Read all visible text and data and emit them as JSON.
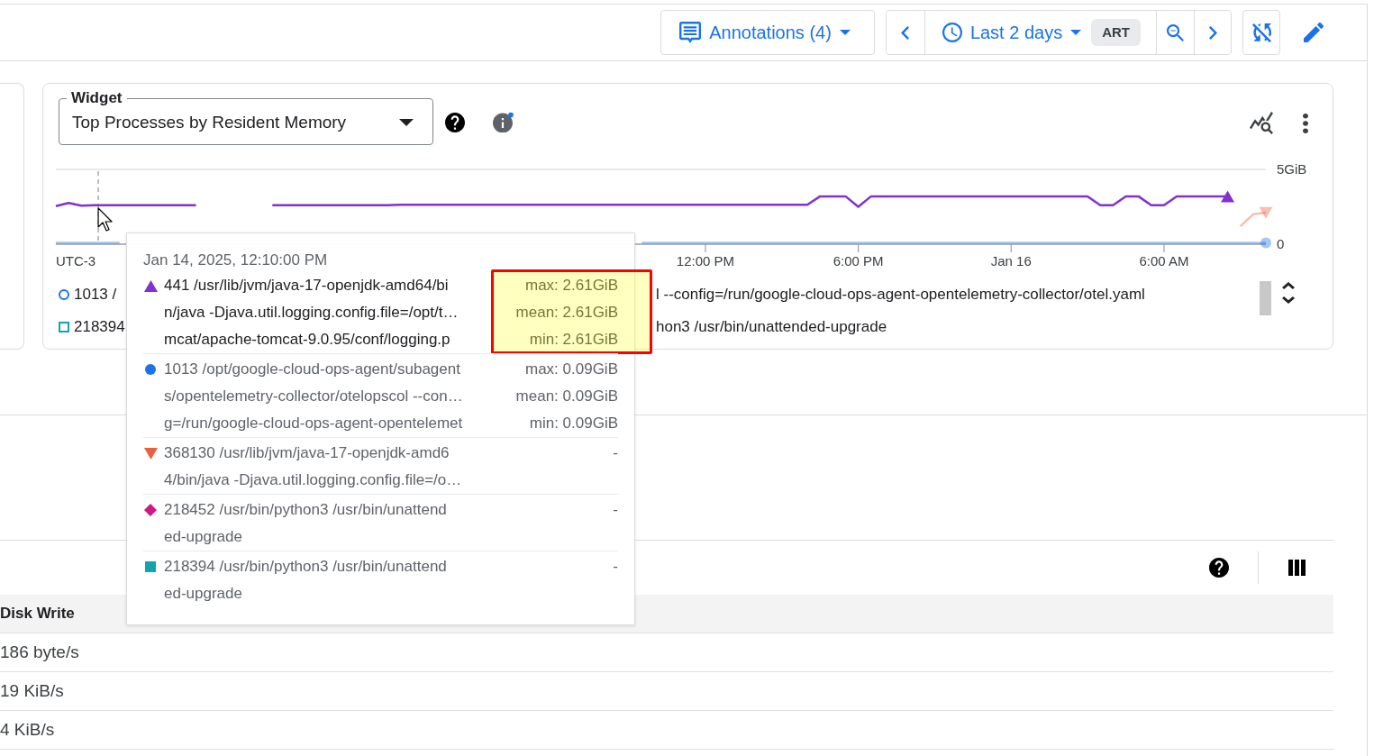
{
  "toolbar": {
    "annotations": "Annotations (4)",
    "range": "Last 2 days",
    "timezone": "ART"
  },
  "widget": {
    "label": "Widget",
    "value": "Top Processes by Resident Memory",
    "info_dot": true,
    "chart_data": {
      "type": "line",
      "xlabel": "UTC-3",
      "categories": [
        null,
        null,
        null,
        null,
        null,
        null,
        null,
        null,
        null,
        null,
        null,
        null,
        null,
        null,
        null,
        null,
        null,
        null,
        null,
        null,
        null,
        null,
        null,
        null,
        null,
        null,
        null,
        null,
        null,
        null,
        null,
        null,
        null,
        null,
        null,
        null,
        null,
        null,
        null,
        null,
        null,
        null,
        null,
        null,
        null,
        null,
        null,
        null,
        null,
        null,
        null,
        "12:00 PM",
        null,
        null,
        null,
        null,
        null,
        null,
        null,
        null,
        null,
        null,
        null,
        "6:00 PM",
        null,
        null,
        null,
        null,
        null,
        null,
        null,
        null,
        null,
        null,
        null,
        "Jan 16",
        null,
        null,
        null,
        null,
        null,
        null,
        null,
        null,
        null,
        null,
        null,
        "6:00 AM",
        null,
        null,
        null,
        null,
        null,
        null,
        null,
        null
      ],
      "ylim": [
        0,
        5
      ],
      "yticks": [
        {
          "value": 0,
          "label": "0"
        },
        {
          "value": 5,
          "label": "5GiB"
        }
      ],
      "series": [
        {
          "color": "#8430ce",
          "values": [
            2.55,
            2.75,
            2.58,
            2.61,
            2.61,
            2.61,
            2.61,
            2.61,
            2.61,
            2.61,
            2.61,
            2.61,
            null,
            null,
            null,
            null,
            null,
            2.6,
            2.6,
            2.6,
            2.6,
            2.6,
            2.6,
            2.6,
            2.6,
            2.6,
            2.6,
            2.63,
            2.63,
            2.63,
            2.63,
            2.63,
            2.63,
            2.63,
            2.63,
            2.63,
            2.63,
            2.63,
            2.63,
            2.63,
            2.63,
            2.63,
            2.63,
            2.63,
            2.63,
            2.63,
            2.63,
            2.63,
            2.63,
            2.63,
            2.63,
            2.63,
            2.63,
            2.63,
            2.63,
            2.63,
            2.63,
            2.63,
            2.63,
            2.63,
            3.2,
            3.2,
            3.2,
            2.5,
            3.2,
            3.2,
            3.2,
            3.2,
            3.2,
            3.2,
            3.2,
            3.2,
            3.2,
            3.2,
            3.2,
            3.2,
            3.2,
            3.2,
            3.2,
            3.2,
            3.2,
            3.2,
            2.6,
            2.6,
            3.2,
            3.2,
            2.6,
            2.6,
            3.2,
            3.2,
            3.2,
            3.2,
            3.2,
            null,
            null,
            null
          ]
        },
        {
          "color": "#1a73e8",
          "values": [
            0.09,
            0.09,
            0.09,
            0.09,
            0.09,
            0.09,
            null,
            null,
            null,
            null,
            null,
            null,
            null,
            null,
            null,
            null,
            null,
            null,
            null,
            null,
            null,
            null,
            null,
            null,
            null,
            null,
            null,
            null,
            null,
            null,
            null,
            null,
            null,
            null,
            null,
            null,
            null,
            null,
            null,
            null,
            null,
            null,
            null,
            null,
            null,
            null,
            0.09,
            0.09,
            0.09,
            0.09,
            0.09,
            0.09,
            0.09,
            0.09,
            0.09,
            0.09,
            0.09,
            0.09,
            0.09,
            0.09,
            0.09,
            0.09,
            0.09,
            0.09,
            0.09,
            0.09,
            0.09,
            0.09,
            0.09,
            0.09,
            0.09,
            0.09,
            0.09,
            0.09,
            0.09,
            0.09,
            0.09,
            0.09,
            0.09,
            0.09,
            0.09,
            0.09,
            0.09,
            0.09,
            0.09,
            0.09,
            0.09,
            0.09,
            0.09,
            0.09,
            0.09,
            0.09,
            0.09,
            0.09,
            0.09,
            0.09
          ]
        },
        {
          "color": "#e8603c",
          "values": [
            null,
            null,
            null,
            null,
            null,
            null,
            null,
            null,
            null,
            null,
            null,
            null,
            null,
            null,
            null,
            null,
            null,
            null,
            null,
            null,
            null,
            null,
            null,
            null,
            null,
            null,
            null,
            null,
            null,
            null,
            null,
            null,
            null,
            null,
            null,
            null,
            null,
            null,
            null,
            null,
            null,
            null,
            null,
            null,
            null,
            null,
            null,
            null,
            null,
            null,
            null,
            null,
            null,
            null,
            null,
            null,
            null,
            null,
            null,
            null,
            null,
            null,
            null,
            null,
            null,
            null,
            null,
            null,
            null,
            null,
            null,
            null,
            null,
            null,
            null,
            null,
            null,
            null,
            null,
            null,
            null,
            null,
            null,
            null,
            null,
            null,
            null,
            null,
            null,
            null,
            null,
            null,
            null,
            1.2,
            2.0,
            2.1
          ]
        }
      ]
    },
    "legend_rows": [
      {
        "kind": "circle",
        "color": "#1a73e8",
        "start": "1013 /",
        "end": "l --config=/run/google-cloud-ops-agent-opentelemetry-collector/otel.yaml"
      },
      {
        "kind": "square",
        "color": "#12a4af",
        "start": "218394",
        "end": "hon3 /usr/bin/unattended-upgrade"
      }
    ]
  },
  "tooltip": {
    "time": "Jan 14, 2025, 12:10:00 PM",
    "entries": [
      {
        "kind": "triangle",
        "color": "#8430ce",
        "emphasized": true,
        "highlight_box": true,
        "lines": [
          "441 /usr/lib/jvm/java-17-openjdk-amd64/bi",
          "n/java -Djava.util.logging.config.file=/opt/t…",
          "mcat/apache-tomcat-9.0.95/conf/logging.p"
        ],
        "values": [
          "max: 2.61GiB",
          "mean: 2.61GiB",
          "min: 2.61GiB"
        ]
      },
      {
        "kind": "circle",
        "color": "#1a73e8",
        "emphasized": false,
        "highlight_box": false,
        "lines": [
          "1013 /opt/google-cloud-ops-agent/subagent",
          "s/opentelemetry-collector/otelopscol --con…",
          "g=/run/google-cloud-ops-agent-opentelemet"
        ],
        "values": [
          "max: 0.09GiB",
          "mean: 0.09GiB",
          "min: 0.09GiB"
        ]
      },
      {
        "kind": "triangle_down",
        "color": "#e8603c",
        "emphasized": false,
        "highlight_box": false,
        "lines": [
          "368130 /usr/lib/jvm/java-17-openjdk-amd6",
          "4/bin/java -Djava.util.logging.config.file=/o…"
        ],
        "values": [
          "-"
        ]
      },
      {
        "kind": "diamond",
        "color": "#d01884",
        "emphasized": false,
        "highlight_box": false,
        "lines": [
          "218452 /usr/bin/python3 /usr/bin/unattend",
          "ed-upgrade"
        ],
        "values": [
          "-"
        ]
      },
      {
        "kind": "square",
        "color": "#12a4af",
        "emphasized": false,
        "highlight_box": false,
        "lines": [
          "218394 /usr/bin/python3 /usr/bin/unattend",
          "ed-upgrade"
        ],
        "values": [
          "-"
        ]
      }
    ]
  },
  "table": {
    "columns": [
      "Disk Write"
    ],
    "rows": [
      [
        "186 byte/s"
      ],
      [
        "19 KiB/s"
      ],
      [
        "4 KiB/s"
      ]
    ]
  }
}
